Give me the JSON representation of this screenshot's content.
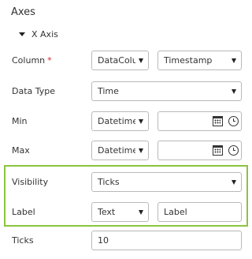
{
  "panel": {
    "title": "Axes"
  },
  "x_axis": {
    "section_label": "X Axis",
    "column": {
      "label": "Column",
      "required_mark": "*",
      "source_value": "DataColu",
      "field_value": "Timestamp"
    },
    "data_type": {
      "label": "Data Type",
      "value": "Time"
    },
    "min": {
      "label": "Min",
      "mode_value": "Datetime",
      "date_value": ""
    },
    "max": {
      "label": "Max",
      "mode_value": "Datetime",
      "date_value": ""
    },
    "visibility": {
      "label": "Visibility",
      "value": "Ticks"
    },
    "label": {
      "label": "Label",
      "mode_value": "Text",
      "text_placeholder": "Label"
    },
    "ticks": {
      "label": "Ticks",
      "value": "10"
    }
  },
  "highlight_color": "#8ac53e"
}
